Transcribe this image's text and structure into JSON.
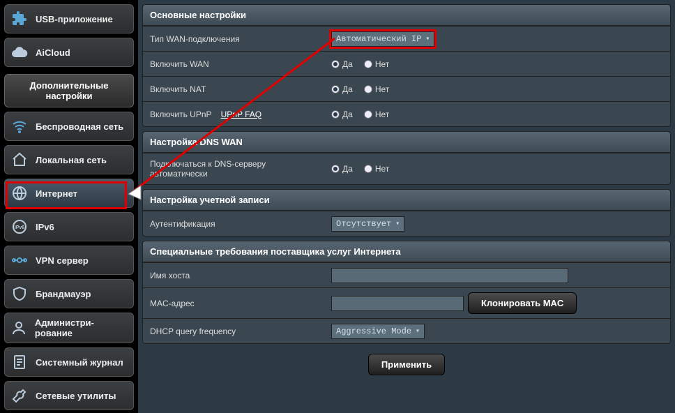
{
  "sidebar": {
    "top_items": [
      {
        "label": "USB-приложение"
      },
      {
        "label": "AiCloud"
      }
    ],
    "section_title": "Дополнительные настройки",
    "items": [
      {
        "label": "Беспроводная сеть"
      },
      {
        "label": "Локальная сеть"
      },
      {
        "label": "Интернет"
      },
      {
        "label": "IPv6"
      },
      {
        "label": "VPN сервер"
      },
      {
        "label": "Брандмауэр"
      },
      {
        "label": "Администри-рование"
      },
      {
        "label": "Системный журнал"
      },
      {
        "label": "Сетевые утилиты"
      }
    ]
  },
  "sections": {
    "basic": {
      "title": "Основные настройки",
      "wan_type_label": "Тип WAN-подключения",
      "wan_type_value": "Автоматический IP",
      "enable_wan_label": "Включить WAN",
      "enable_nat_label": "Включить NAT",
      "enable_upnp_label": "Включить UPnP",
      "upnp_link": "UPnP  FAQ"
    },
    "dns": {
      "title": "Настройка DNS WAN",
      "auto_label": "Подключаться к DNS-серверу автоматически"
    },
    "account": {
      "title": "Настройка учетной записи",
      "auth_label": "Аутентификация",
      "auth_value": "Отсутствует"
    },
    "isp": {
      "title": "Специальные требования поставщика услуг Интернета",
      "host_label": "Имя хоста",
      "host_value": "",
      "mac_label": "MAC-адрес",
      "mac_value": "",
      "clone_mac": "Клонировать MAC",
      "dhcp_label": "DHCP query frequency",
      "dhcp_value": "Aggressive Mode"
    }
  },
  "radio": {
    "yes": "Да",
    "no": "Нет"
  },
  "apply_label": "Применить"
}
